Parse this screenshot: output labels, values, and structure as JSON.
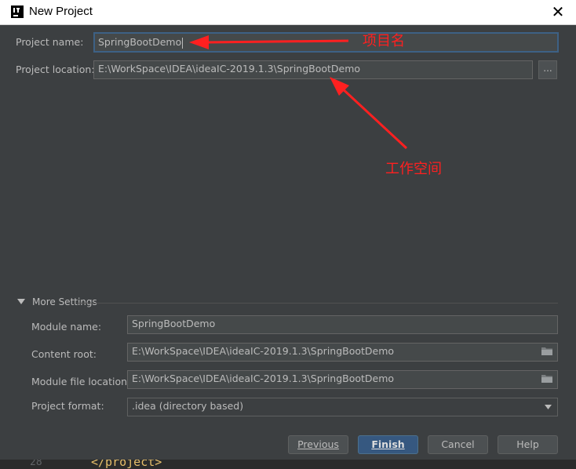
{
  "window": {
    "title": "New Project",
    "close_glyph": "✕"
  },
  "form": {
    "project_name_label": "Project name:",
    "project_name_value": "SpringBootDemo",
    "project_location_label": "Project location:",
    "project_location_value": "E:\\WorkSpace\\IDEA\\ideaIC-2019.1.3\\SpringBootDemo",
    "browse_label": "..."
  },
  "annotations": {
    "name_note": "项目名",
    "workspace_note": "工作空间",
    "color": "#ff2020"
  },
  "more_settings": {
    "toggle_label": "More Settings",
    "module_name_label": "Module name:",
    "module_name_value": "SpringBootDemo",
    "content_root_label": "Content root:",
    "content_root_value": "E:\\WorkSpace\\IDEA\\ideaIC-2019.1.3\\SpringBootDemo",
    "module_file_location_label": "Module file location:",
    "module_file_location_value": "E:\\WorkSpace\\IDEA\\ideaIC-2019.1.3\\SpringBootDemo",
    "project_format_label": "Project format:",
    "project_format_value": ".idea (directory based)"
  },
  "buttons": {
    "previous": "Previous",
    "finish": "Finish",
    "cancel": "Cancel",
    "help": "Help"
  },
  "background_editor": {
    "line_number": "28",
    "code_text": "</project>"
  },
  "icons": [
    "app-logo-icon",
    "close-icon",
    "folder-icon",
    "chevron-down-icon",
    "triangle-down-icon"
  ],
  "colors": {
    "dialog_bg": "#3c3f41",
    "field_bg": "#45494a",
    "primary_button": "#365880",
    "focus_border": "#3d6185"
  }
}
